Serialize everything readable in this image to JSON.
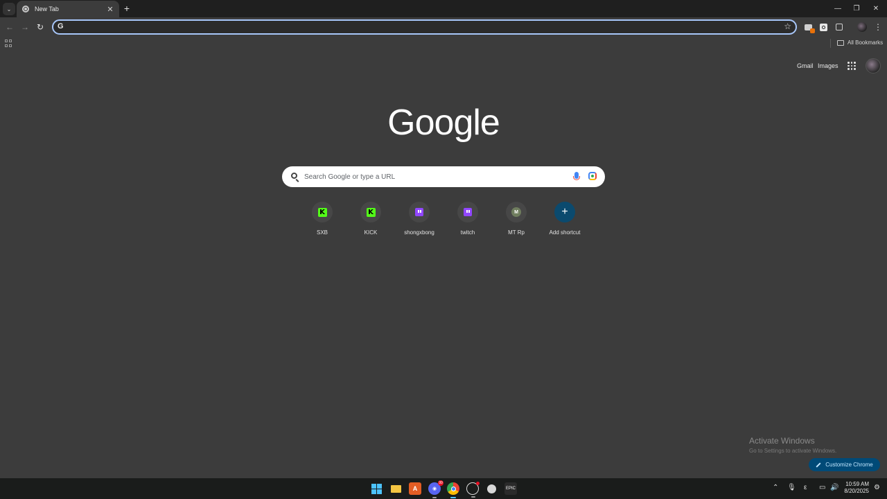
{
  "tab": {
    "title": "New Tab",
    "close": "✕"
  },
  "window_controls": {
    "minimize": "—",
    "restore": "❐",
    "close": "✕"
  },
  "toolbar": {
    "back": "←",
    "forward": "→",
    "reload": "↻"
  },
  "omnibox": {
    "g_letter": "G",
    "value": "",
    "star": "☆"
  },
  "bookmarks": {
    "all_bookmarks": "All Bookmarks"
  },
  "ntp": {
    "gmail": "Gmail",
    "images": "Images",
    "logo": "Google",
    "search_placeholder": "Search Google or type a URL",
    "shortcuts": [
      {
        "label": "SXB",
        "icon": "kick-icon"
      },
      {
        "label": "KICK",
        "icon": "kick-icon"
      },
      {
        "label": "shongxbong",
        "icon": "twitch-icon"
      },
      {
        "label": "twitch",
        "icon": "twitch-icon"
      },
      {
        "label": "MT Rp",
        "icon": "m-letter-icon",
        "letter": "M"
      },
      {
        "label": "Add shortcut",
        "icon": "plus-icon",
        "symbol": "+"
      }
    ],
    "customize": "Customize Chrome"
  },
  "activation": {
    "title": "Activate Windows",
    "subtitle": "Go to Settings to activate Windows."
  },
  "taskbar": {
    "discord_badge": "99",
    "tray_ime": "ε",
    "time": "10:59 AM",
    "date": "8/20/2025"
  },
  "colors": {
    "background": "#3c3c3c",
    "accent": "#a8c7fa",
    "kick_green": "#53fc18",
    "twitch_purple": "#9146ff",
    "customize_bg": "#004a77"
  }
}
